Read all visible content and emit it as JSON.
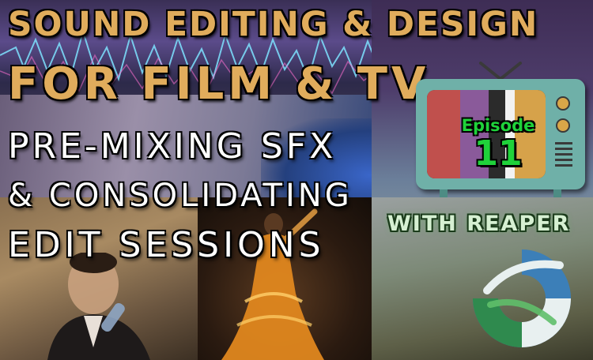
{
  "title": {
    "line1": "SOUND EDITING & DESIGN",
    "line2": "FOR FILM & TV"
  },
  "subtitle": {
    "line1": "PRE-MIXING SFX",
    "line2": "& CONSOLIDATING",
    "line3": "EDIT SESSIONS"
  },
  "episode": {
    "label": "Episode",
    "number": "11"
  },
  "badge": {
    "text": "WITH REAPER"
  },
  "icons": {
    "tv": "retro-tv-icon",
    "logo": "reaper-logo-icon"
  },
  "colors": {
    "title_gold": "#e0ac5c",
    "subtitle_white": "#ffffff",
    "episode_green": "#1fd23a",
    "tv_teal": "#6fb0a8",
    "tv_bars": [
      "#c0504d",
      "#8a5a9a",
      "#2b2b2b",
      "#d6a24a"
    ]
  }
}
